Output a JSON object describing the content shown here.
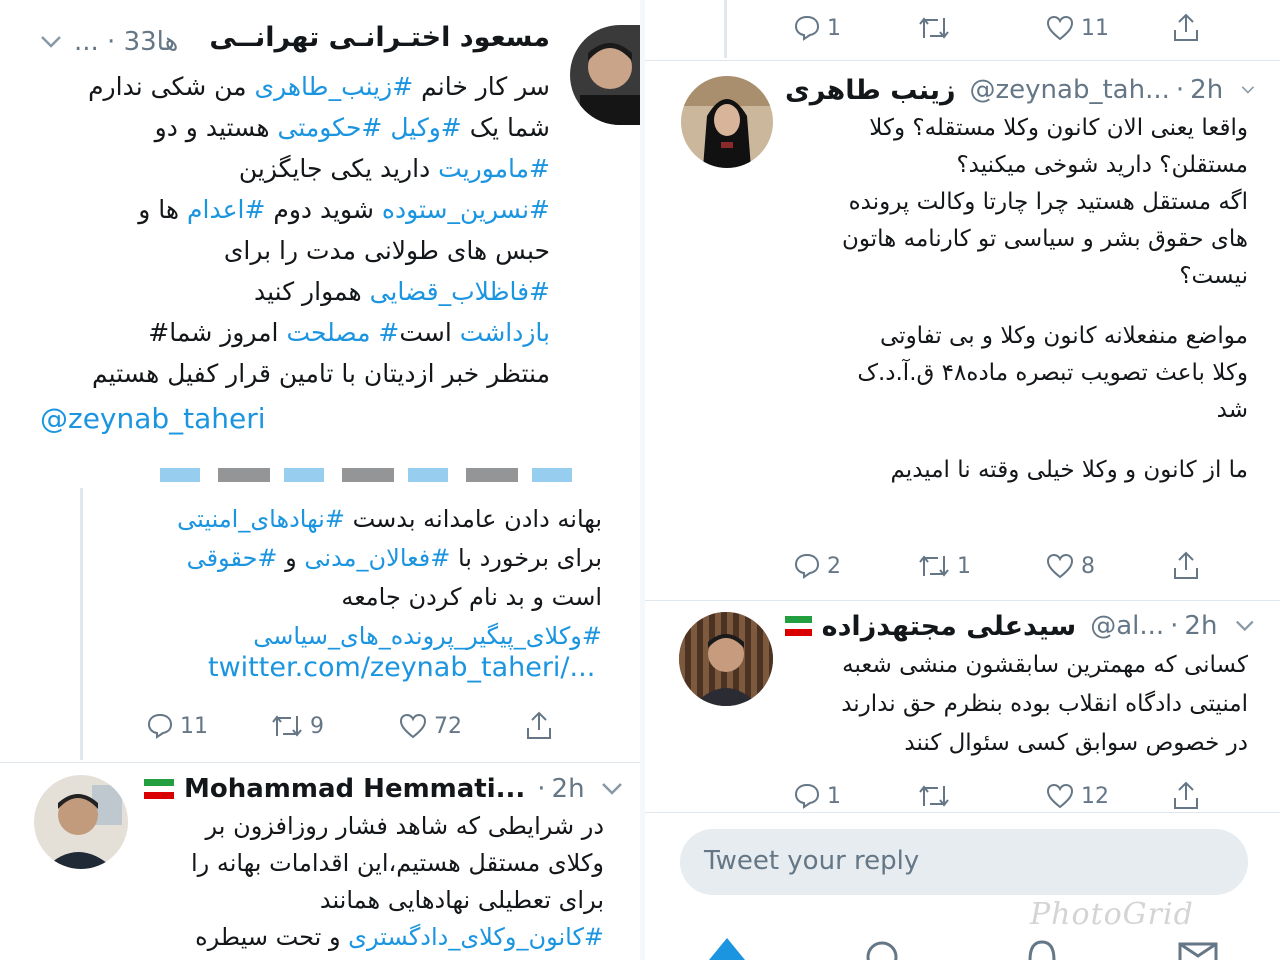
{
  "left": {
    "tweet1": {
      "name": "مسعود اختـرانـی تهرانــی",
      "meta": "... · 33ها",
      "lines": [
        [
          {
            "t": "سر کار خانم "
          },
          {
            "t": "#زینب_طاهری",
            "h": 1
          },
          {
            "t": " من شکی ندارم"
          }
        ],
        [
          {
            "t": "شما یک "
          },
          {
            "t": "#وکیل",
            "h": 1
          },
          {
            "t": " "
          },
          {
            "t": "#حکومتی",
            "h": 1
          },
          {
            "t": " هستید و دو"
          }
        ],
        [
          {
            "t": "#ماموریت",
            "h": 1
          },
          {
            "t": " دارید یکی جایگزین"
          }
        ],
        [
          {
            "t": "#نسرین_ستوده",
            "h": 1
          },
          {
            "t": " شوید دوم "
          },
          {
            "t": "#اعدام",
            "h": 1
          },
          {
            "t": " ها و"
          }
        ],
        [
          {
            "t": "حبس های طولانی مدت را برای"
          }
        ],
        [
          {
            "t": "#فاظلاب_قضایی",
            "h": 1
          },
          {
            "t": " هموار کنید"
          }
        ],
        [
          {
            "t": "بازداشت",
            "h": 1
          },
          {
            "t": " است"
          },
          {
            "t": "# مصلحت",
            "h": 1
          },
          {
            "t": " امروز شما#"
          }
        ],
        [
          {
            "t": "منتظر خبر ازدیتان با تامین قرار کفیل هستیم"
          }
        ]
      ],
      "mention": "@zeynab_taheri"
    },
    "tweet2": {
      "lines": [
        [
          {
            "t": "بهانه دادن عامدانه بدست "
          },
          {
            "t": "#نهادهای_امنیتی",
            "h": 1
          }
        ],
        [
          {
            "t": "برای برخورد با "
          },
          {
            "t": "#فعالان_مدنی",
            "h": 1
          },
          {
            "t": "  و  "
          },
          {
            "t": "#حقوقی",
            "h": 1
          }
        ],
        [
          {
            "t": "است و بد نام کردن جامعه"
          }
        ],
        [
          {
            "t": "#وکلای_پیگیر_پرونده_های_سیاسی",
            "h": 1
          }
        ]
      ],
      "link": "twitter.com/zeynab_taheri/...",
      "reply_count": "11",
      "retweet_count": "9",
      "like_count": "72"
    },
    "tweet3": {
      "name": "Mohammad Hemmati...",
      "time": "2h",
      "lines": [
        [
          {
            "t": "در شرایطی که شاهد فشار روزافزون بر"
          }
        ],
        [
          {
            "t": "وکلای مستقل هستیم،این اقدامات بهانه را"
          }
        ],
        [
          {
            "t": "برای تعطیلی نهادهایی همانند"
          }
        ],
        [
          {
            "t": "#کانون_وکلای_دادگستری",
            "h": 1
          },
          {
            "t": " و تحت سیطره"
          }
        ]
      ]
    }
  },
  "right": {
    "top_actions": {
      "reply_count": "1",
      "like_count": "11"
    },
    "tweet1": {
      "name": "زینب طاهری",
      "handle": "@zeynab_tah...",
      "time": "2h",
      "lines": [
        "واقعا یعنی الان کانون وکلا مستقله؟ وکلا",
        "مستقلن؟ دارید شوخی میکنید؟",
        "اگه مستقل هستید چرا چارتا وکالت پرونده",
        "های حقوق بشر و سیاسی تو کارنامه هاتون",
        "نیست؟",
        "",
        "مواضع منفعلانه کانون وکلا و بی تفاوتی",
        "وکلا باعث تصویب تبصره ماده۴۸ ق.آ.د.ک",
        "شد",
        "",
        "ما از کانون و وکلا خیلی وقته نا امیدیم"
      ],
      "reply_count": "2",
      "retweet_count": "1",
      "like_count": "8"
    },
    "tweet2": {
      "name": "سیدعلی مجتهدزاده",
      "handle": "@al...",
      "time": "2h",
      "lines": [
        "کسانی که مهمترین سابقشون منشی شعبه",
        "امنیتی دادگاه انقلاب بوده بنظرم حق ندارند",
        "در خصوص سوابق کسی سئوال کنند"
      ],
      "reply_count": "1",
      "like_count": "12"
    },
    "reply_placeholder": "Tweet your reply",
    "watermark": "PhotoGrid"
  },
  "colors": {
    "link": "#1b95e0",
    "muted": "#657786",
    "border": "#e1e8ed"
  }
}
